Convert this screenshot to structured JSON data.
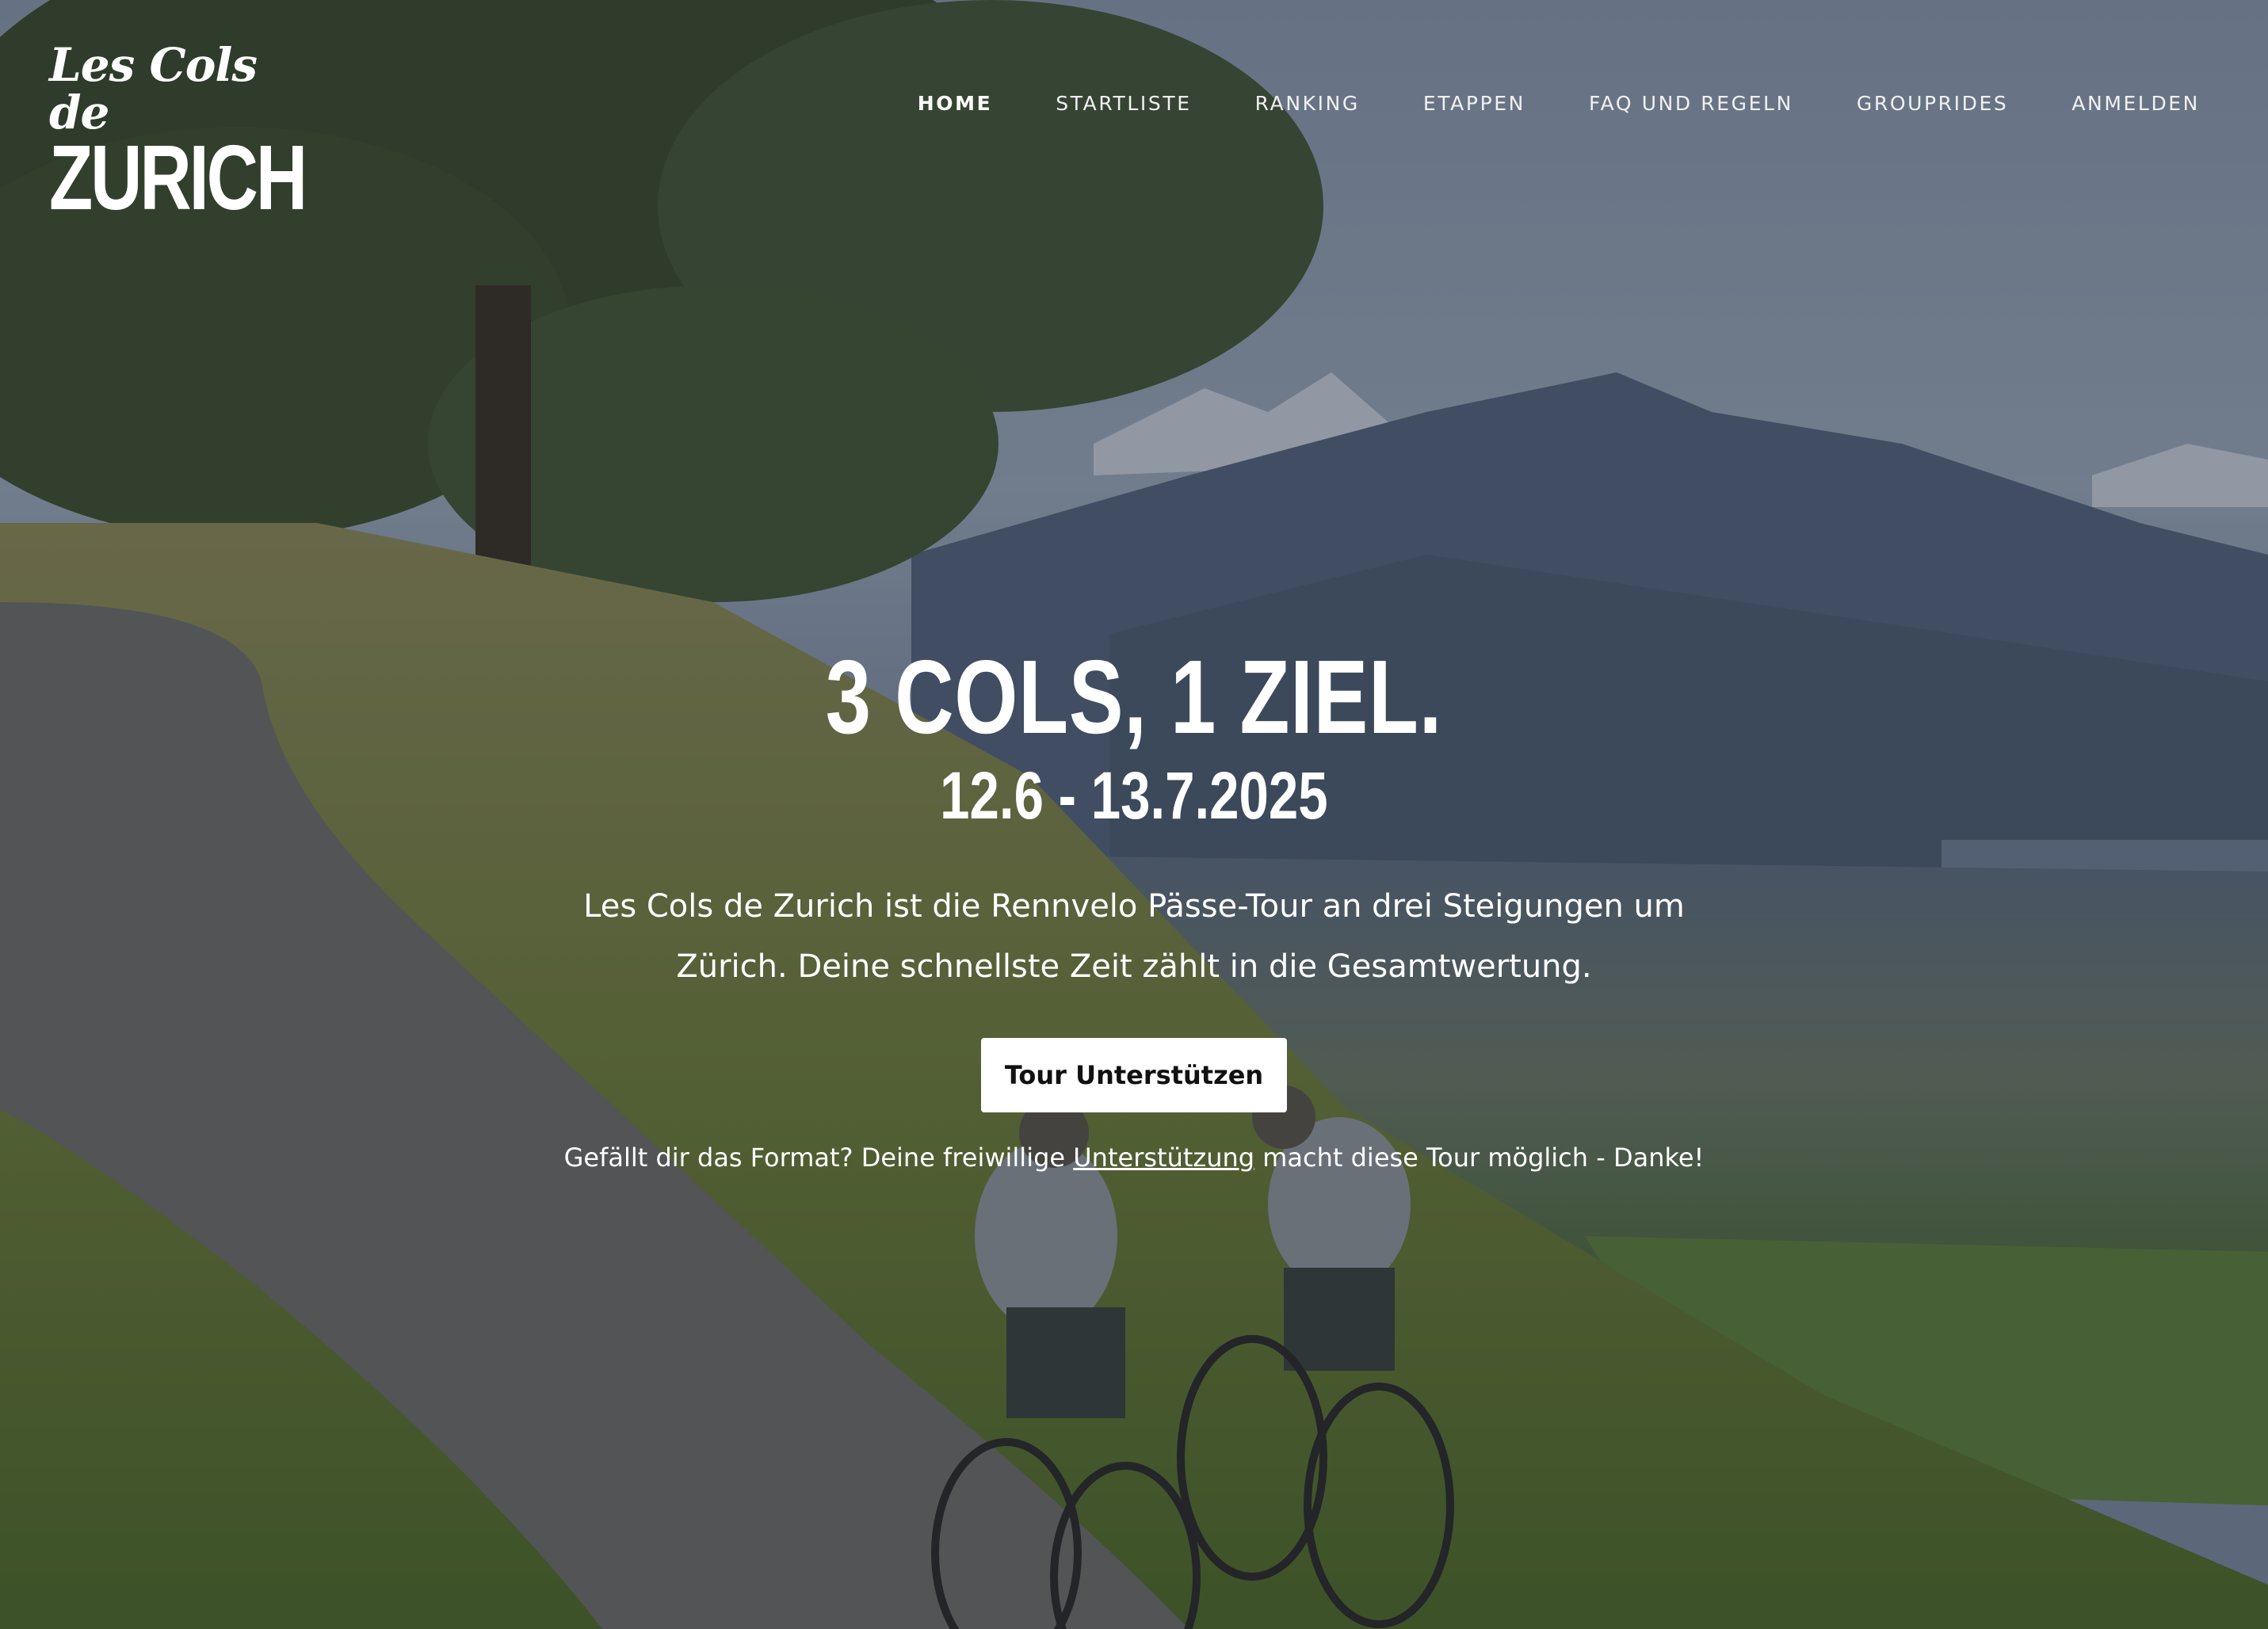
{
  "logo": {
    "script_text": "Les Cols de",
    "main_text": "ZURICH"
  },
  "nav": {
    "items": [
      {
        "label": "HOME",
        "active": true
      },
      {
        "label": "STARTLISTE"
      },
      {
        "label": "RANKING"
      },
      {
        "label": "ETAPPEN"
      },
      {
        "label": "FAQ UND REGELN"
      },
      {
        "label": "GROUPRIDES"
      },
      {
        "label": "ANMELDEN"
      }
    ]
  },
  "hero": {
    "headline": "3 COLS, 1 ZIEL.",
    "dates": "12.6 - 13.7.2025",
    "description": "Les Cols de Zurich ist die Rennvelo Pässe-Tour an drei Steigungen um Zürich. Deine schnellste Zeit zählt in die Gesamtwertung.",
    "cta_label": "Tour Unterstützen",
    "note_before": "Gefällt dir das Format? Deine freiwillige ",
    "note_link": "Unterstützung",
    "note_after": " macht diese Tour möglich - Danke!"
  },
  "colors": {
    "text": "#ffffff",
    "button_bg": "#ffffff",
    "button_text": "#111111"
  }
}
